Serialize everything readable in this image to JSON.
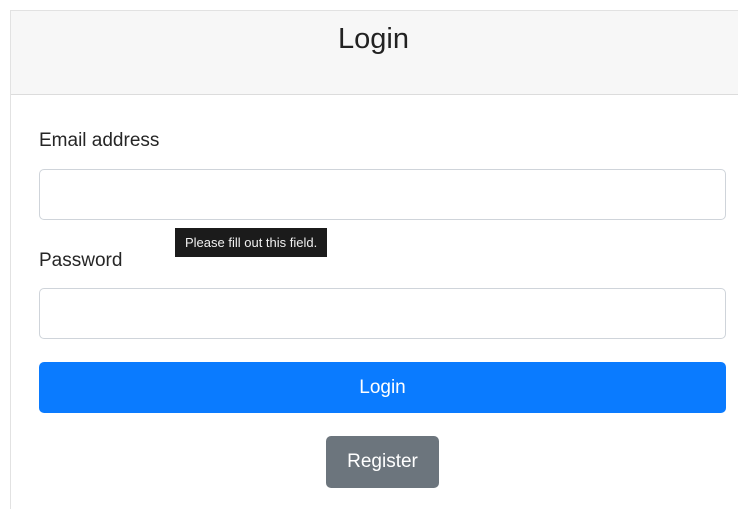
{
  "header": {
    "title": "Login"
  },
  "form": {
    "email": {
      "label": "Email address",
      "value": "",
      "placeholder": ""
    },
    "password": {
      "label": "Password",
      "value": "",
      "placeholder": ""
    },
    "validation_tooltip": "Please fill out this field.",
    "login_button": "Login",
    "register_button": "Register"
  },
  "colors": {
    "primary": "#0a7bff",
    "secondary": "#6c757d",
    "header_bg": "#f7f7f7",
    "tooltip_bg": "#1b1b1b"
  }
}
